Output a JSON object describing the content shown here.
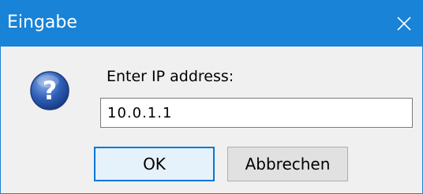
{
  "window": {
    "title": "Eingabe",
    "close_icon": "close-icon",
    "accent_color": "#1883d7"
  },
  "dialog": {
    "icon": "question-icon",
    "prompt": "Enter IP address:",
    "input_value": "10.0.1.1",
    "buttons": {
      "ok_label": "OK",
      "cancel_label": "Abbrechen"
    }
  }
}
